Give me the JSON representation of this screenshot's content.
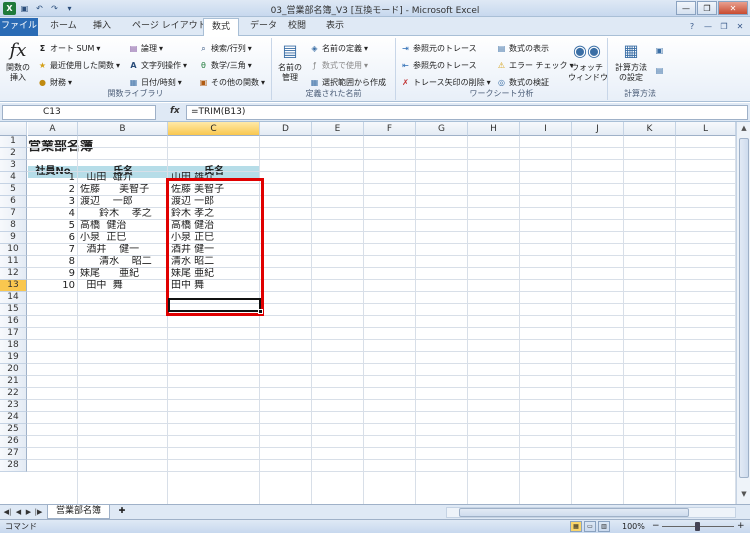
{
  "window": {
    "title": "03_営業部名簿_V3 [互換モード] - Microsoft Excel",
    "controls": {
      "minimize": "—",
      "restore": "❐",
      "close": "✕"
    }
  },
  "qat": {
    "logo": "X"
  },
  "tabs": [
    {
      "label": "ファイル"
    },
    {
      "label": "ホーム"
    },
    {
      "label": "挿入"
    },
    {
      "label": "ページ レイアウト"
    },
    {
      "label": "数式"
    },
    {
      "label": "データ"
    },
    {
      "label": "校閲"
    },
    {
      "label": "表示"
    }
  ],
  "ribbon": {
    "insert_function": {
      "icon": "fx",
      "label": "関数の\n挿入"
    },
    "lib_col1": [
      "オート SUM",
      "最近使用した関数",
      "財務"
    ],
    "lib_col2": [
      "論理",
      "文字列操作",
      "日付/時刻"
    ],
    "lib_col3": [
      "検索/行列",
      "数学/三角",
      "その他の関数"
    ],
    "group_library": "関数ライブラリ",
    "name_manager": "名前の\n管理",
    "names_items": [
      "名前の定義",
      "数式で使用",
      "選択範囲から作成"
    ],
    "group_names": "定義された名前",
    "audit_col1": [
      "参照元のトレース",
      "参照先のトレース",
      "トレース矢印の削除"
    ],
    "audit_col2": [
      "数式の表示",
      "エラー チェック",
      "数式の検証"
    ],
    "watch": "ウォッチ\nウィンドウ",
    "group_audit": "ワークシート分析",
    "calc_options": "計算方法\nの設定",
    "group_calc": "計算方法"
  },
  "formula_bar": {
    "name_box": "C13",
    "fx": "fx",
    "formula": "=TRIM(B13)"
  },
  "columns": [
    "A",
    "B",
    "C",
    "D",
    "E",
    "F",
    "G",
    "H",
    "I",
    "J",
    "K",
    "L"
  ],
  "rows": [
    "1",
    "2",
    "3",
    "4",
    "5",
    "6",
    "7",
    "8",
    "9",
    "10",
    "11",
    "12",
    "13",
    "14",
    "15",
    "16",
    "17",
    "18",
    "19",
    "20",
    "21",
    "22",
    "23",
    "24",
    "25",
    "26",
    "27",
    "28"
  ],
  "sheet": {
    "title": "営業部名簿",
    "headers": [
      "社員No",
      "氏名",
      "氏名"
    ],
    "records": [
      {
        "no": "1",
        "raw": "  山田  雄介",
        "trim": "山田 雄介"
      },
      {
        "no": "2",
        "raw": "佐藤      美智子",
        "trim": "佐藤 美智子"
      },
      {
        "no": "3",
        "raw": "渡辺    一郎",
        "trim": "渡辺 一郎"
      },
      {
        "no": "4",
        "raw": "      鈴木    孝之",
        "trim": "鈴木 孝之"
      },
      {
        "no": "5",
        "raw": "高橋  健治",
        "trim": "高橋 健治"
      },
      {
        "no": "6",
        "raw": "小泉  正巳",
        "trim": "小泉 正巳"
      },
      {
        "no": "7",
        "raw": "  酒井    健一",
        "trim": "酒井 健一"
      },
      {
        "no": "8",
        "raw": "      清水    昭二",
        "trim": "清水 昭二"
      },
      {
        "no": "9",
        "raw": "妹尾      亜紀",
        "trim": "妹尾 亜紀"
      },
      {
        "no": "10",
        "raw": "  田中  舞",
        "trim": "田中 舞"
      }
    ]
  },
  "sheet_tab": "営業部名簿",
  "status": {
    "mode": "コマンド",
    "zoom": "100%"
  }
}
